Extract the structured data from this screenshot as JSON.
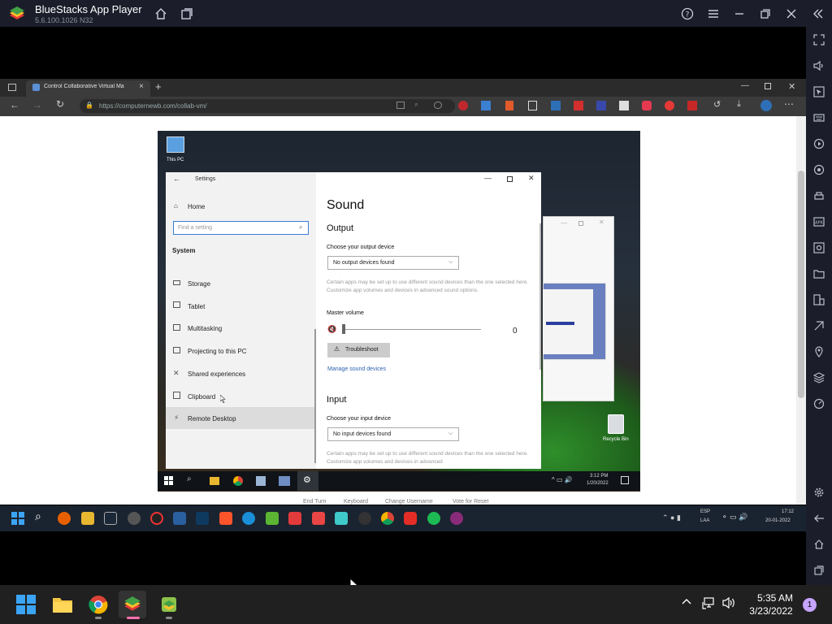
{
  "bluestacks": {
    "title": "BlueStacks App Player",
    "version": "5.6.100.1026 N32"
  },
  "edge": {
    "tab_title": "Control Collaborative Virtual Ma",
    "url": "https://computernewb.com/collab-vm/"
  },
  "desktop": {
    "this_pc": "This PC",
    "recycle_bin": "Recycle Bin"
  },
  "settings": {
    "window_title": "Settings",
    "nav_home": "Home",
    "search_placeholder": "Find a setting",
    "nav_section": "System",
    "nav_items": [
      "Storage",
      "Tablet",
      "Multitasking",
      "Projecting to this PC",
      "Shared experiences",
      "Clipboard",
      "Remote Desktop"
    ],
    "page_title": "Sound",
    "output_heading": "Output",
    "output_device_label": "Choose your output device",
    "output_device_value": "No output devices found",
    "output_desc": "Certain apps may be set up to use different sound devices than the one selected here. Customize app volumes and devices in advanced sound options.",
    "master_volume_label": "Master volume",
    "master_volume_value": "0",
    "troubleshoot_label": "Troubleshoot",
    "manage_link": "Manage sound devices",
    "input_heading": "Input",
    "input_device_label": "Choose your input device",
    "input_device_value": "No input devices found",
    "input_desc": "Certain apps may be set up to use different sound devices than the one selected here. Customize app volumes and devices in advanced"
  },
  "rdp_taskbar": {
    "time": "3:12 PM",
    "date": "1/20/2022"
  },
  "bottom_links": [
    "End Turn",
    "Keyboard",
    "Change Username",
    "Vote for Reset"
  ],
  "host_taskbar": {
    "lang": "ESP",
    "lang2": "LAA",
    "time": "17:12",
    "date": "20-01-2022"
  },
  "win_taskbar": {
    "time": "5:35 AM",
    "date": "3/23/2022",
    "notification_count": "1"
  }
}
